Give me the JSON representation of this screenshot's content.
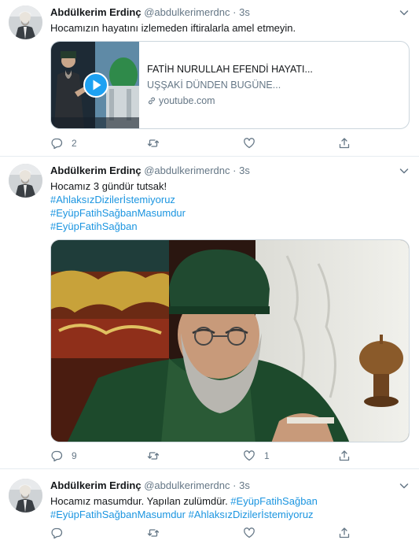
{
  "tweets": [
    {
      "name": "Abdülkerim Erdinç",
      "handle": "@abdulkerimerdnc",
      "separator": "·",
      "time": "3s",
      "text": "Hocamızın hayatını izlemeden iftiralarla amel etmeyin.",
      "card": {
        "title": "FATİH NURULLAH EFENDİ HAYATI...",
        "description": "UŞŞAKİ DÜNDEN BUGÜNE...",
        "domain": "youtube.com"
      },
      "replies": "2",
      "retweets": "",
      "likes": ""
    },
    {
      "name": "Abdülkerim Erdinç",
      "handle": "@abdulkerimerdnc",
      "separator": "·",
      "time": "3s",
      "text": "Hocamız 3 gündür tutsak!",
      "hashtags": [
        "#AhlaksızDizilerİstemiyoruz",
        "#EyüpFatihSağbanMasumdur",
        "#EyüpFatihSağban"
      ],
      "replies": "9",
      "retweets": "",
      "likes": "1"
    },
    {
      "name": "Abdülkerim Erdinç",
      "handle": "@abdulkerimerdnc",
      "separator": "·",
      "time": "3s",
      "text_plain": "Hocamız masumdur. Yapılan zulümdür. ",
      "text_tag1": "#EyüpFatihSağban",
      "text_tag2": "#EyüpFatihSağbanMasumdur",
      "text_tag3": "#AhlaksızDizilerİstemiyoruz",
      "replies": "",
      "retweets": "",
      "likes": ""
    }
  ],
  "colors": {
    "accent": "#1b95e0",
    "muted": "#657786",
    "border": "#e6ecf0",
    "play": "#1da1f2"
  },
  "icons": [
    "chevron-down-icon",
    "reply-icon",
    "retweet-icon",
    "like-icon",
    "share-icon",
    "link-icon",
    "play-icon"
  ]
}
